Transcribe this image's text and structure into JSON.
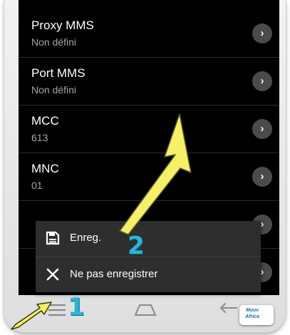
{
  "settings": {
    "rows": [
      {
        "title": "Proxy MMS",
        "value": "Non défini"
      },
      {
        "title": "Port MMS",
        "value": "Non défini"
      },
      {
        "title": "MCC",
        "value": "613"
      },
      {
        "title": "MNC",
        "value": "01"
      },
      {
        "title": "",
        "value": ""
      },
      {
        "title": "",
        "value": ""
      }
    ],
    "chevron_glyph": "›"
  },
  "popup_menu": {
    "save_label": "Enreg.",
    "discard_label": "Ne pas enregistrer"
  },
  "annotations": {
    "step_one": "1",
    "step_two": "2"
  },
  "logo": {
    "line1": "Moov",
    "line2": "Africa"
  },
  "colors": {
    "accent_orange": "#f0621f",
    "annotation_yellow": "#f5ef6a",
    "annotation_blue": "#29b6d9"
  }
}
